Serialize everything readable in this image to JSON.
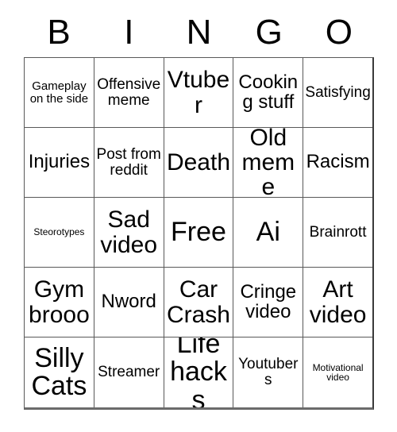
{
  "card": {
    "title": "BINGO",
    "columns": [
      "B",
      "I",
      "N",
      "G",
      "O"
    ],
    "rows": [
      [
        {
          "label": "Gameplay on the side",
          "size": "sm"
        },
        {
          "label": "Offensive meme",
          "size": "md"
        },
        {
          "label": "Vtuber",
          "size": "xl"
        },
        {
          "label": "Cooking stuff",
          "size": "lg"
        },
        {
          "label": "Satisfying",
          "size": "md"
        }
      ],
      [
        {
          "label": "Injuries",
          "size": "lg"
        },
        {
          "label": "Post from reddit",
          "size": "md"
        },
        {
          "label": "Death",
          "size": "xl"
        },
        {
          "label": "Old meme",
          "size": "xl"
        },
        {
          "label": "Racism",
          "size": "lg"
        }
      ],
      [
        {
          "label": "Steorotypes",
          "size": "xs"
        },
        {
          "label": "Sad video",
          "size": "xl"
        },
        {
          "label": "Free",
          "size": "xxl"
        },
        {
          "label": "Ai",
          "size": "xxl"
        },
        {
          "label": "Brainrott",
          "size": "md"
        }
      ],
      [
        {
          "label": "Gym brooo",
          "size": "xl"
        },
        {
          "label": "Nword",
          "size": "lg"
        },
        {
          "label": "Car Crash",
          "size": "xl"
        },
        {
          "label": "Cringe video",
          "size": "lg"
        },
        {
          "label": "Art video",
          "size": "xl"
        }
      ],
      [
        {
          "label": "Silly Cats",
          "size": "xxl"
        },
        {
          "label": "Streamer",
          "size": "md"
        },
        {
          "label": "Life hacks",
          "size": "xxl"
        },
        {
          "label": "Youtubers",
          "size": "md"
        },
        {
          "label": "Motivational video",
          "size": "xs"
        }
      ]
    ],
    "colors": {
      "background": "#ffffff",
      "text": "#000000",
      "gridline": "#595959"
    }
  }
}
